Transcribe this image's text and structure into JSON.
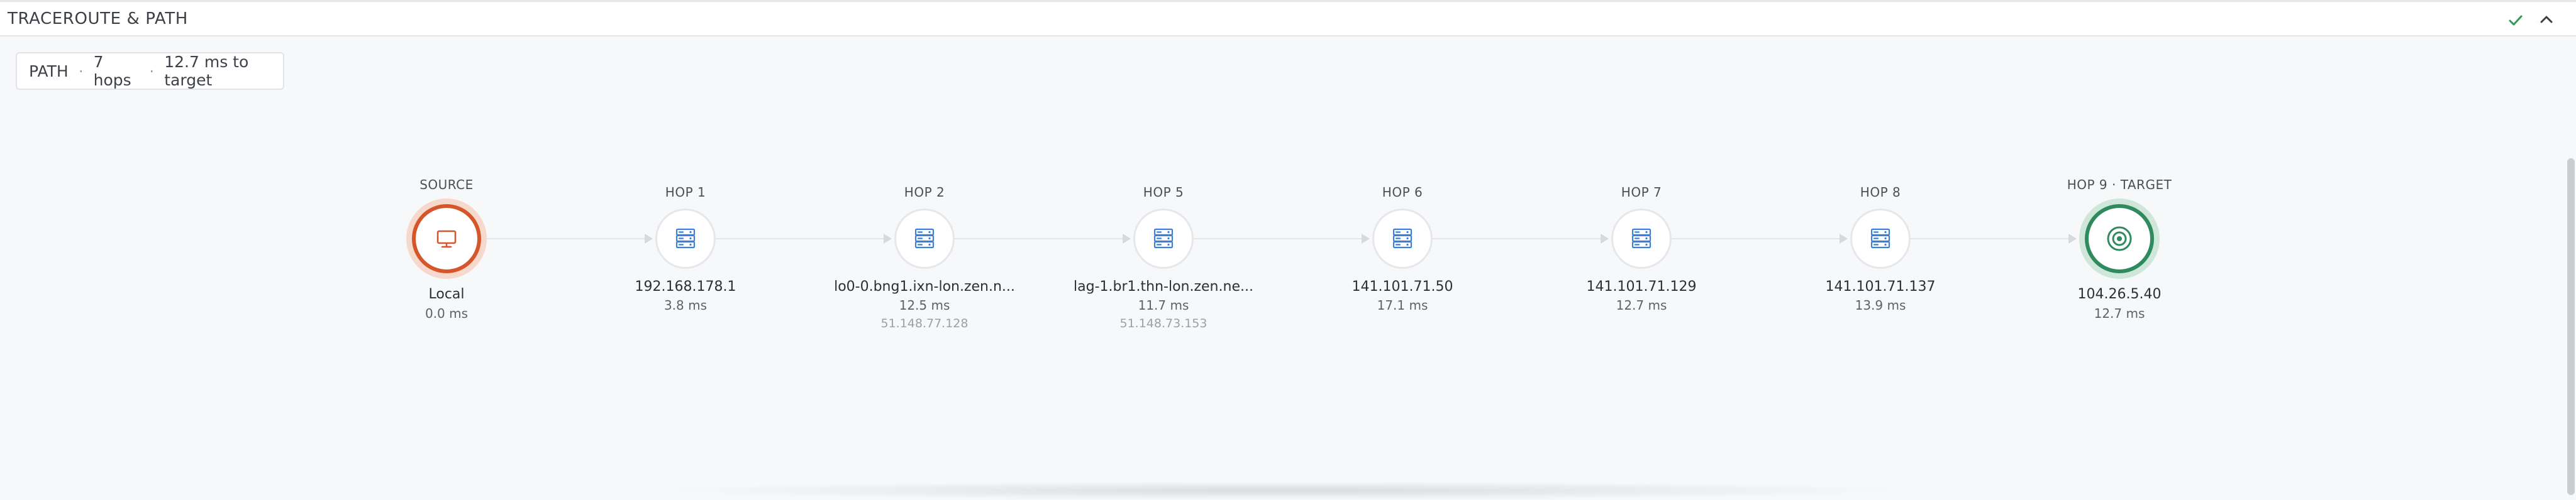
{
  "header": {
    "title": "TRACEROUTE & PATH"
  },
  "summary": {
    "label": "PATH",
    "hops": "7 hops",
    "latency": "12.7 ms to target"
  },
  "colors": {
    "source": "#d4562a",
    "target": "#2f8a5e",
    "hop_icon": "#3b7fd8"
  },
  "nodes": [
    {
      "kind": "source",
      "top_label": "SOURCE",
      "name": "Local",
      "ms": "0.0 ms",
      "ip": "",
      "icon": "monitor-icon"
    },
    {
      "kind": "hop",
      "top_label": "HOP 1",
      "name": "192.168.178.1",
      "ms": "3.8 ms",
      "ip": "",
      "icon": "server-icon"
    },
    {
      "kind": "hop",
      "top_label": "HOP 2",
      "name": "lo0-0.bng1.ixn-lon.zen.n...",
      "ms": "12.5 ms",
      "ip": "51.148.77.128",
      "icon": "server-icon"
    },
    {
      "kind": "hop",
      "top_label": "HOP 5",
      "name": "lag-1.br1.thn-lon.zen.ne...",
      "ms": "11.7 ms",
      "ip": "51.148.73.153",
      "icon": "server-icon"
    },
    {
      "kind": "hop",
      "top_label": "HOP 6",
      "name": "141.101.71.50",
      "ms": "17.1 ms",
      "ip": "",
      "icon": "server-icon"
    },
    {
      "kind": "hop",
      "top_label": "HOP 7",
      "name": "141.101.71.129",
      "ms": "12.7 ms",
      "ip": "",
      "icon": "server-icon"
    },
    {
      "kind": "hop",
      "top_label": "HOP 8",
      "name": "141.101.71.137",
      "ms": "13.9 ms",
      "ip": "",
      "icon": "server-icon"
    },
    {
      "kind": "target",
      "top_label": "HOP 9 · TARGET",
      "name": "104.26.5.40",
      "ms": "12.7 ms",
      "ip": "",
      "icon": "target-icon"
    }
  ]
}
